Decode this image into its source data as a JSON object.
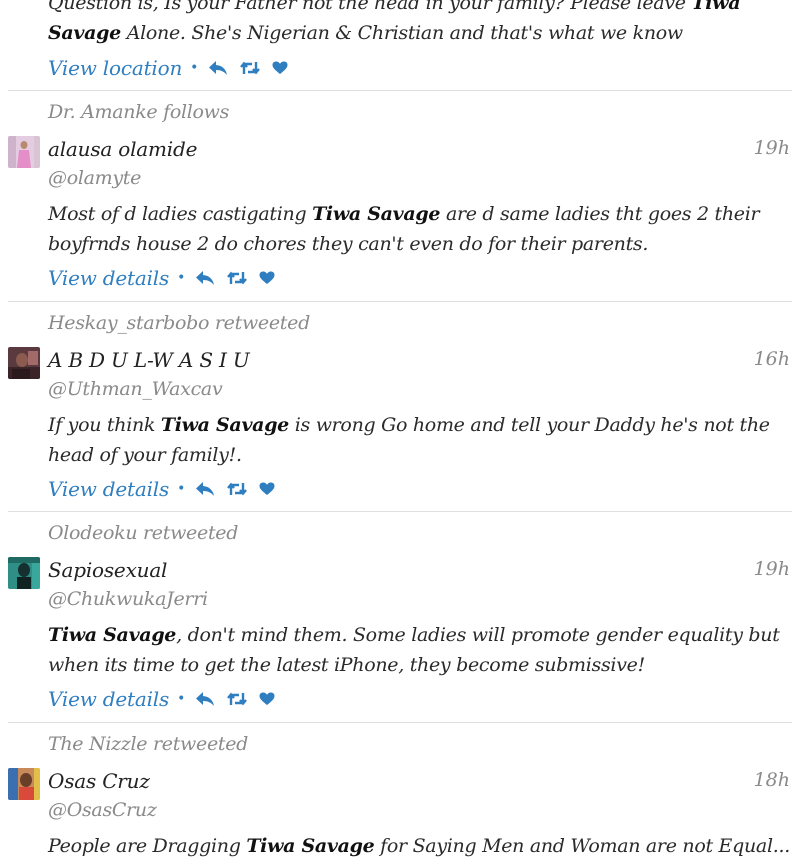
{
  "colors": {
    "link": "#2f7ec0",
    "muted": "#8a8a8a",
    "text": "#2a2a2a",
    "divider": "#dfdfdf"
  },
  "icons": [
    "reply-icon",
    "retweet-icon",
    "favorite-icon"
  ],
  "top_partial": {
    "line1_prefix": "Question is, Is your Father not the head in your family? Please leave ",
    "line1_bold": "Tiwa",
    "line2_bold": "Savage",
    "line2_rest": " Alone. She's Nigerian & Christian and that's what we know",
    "action_label": "View location"
  },
  "tweets": [
    {
      "context": "Dr. Amanke follows",
      "name": "alausa olamide",
      "handle": "@olamyte",
      "time": "19h",
      "text": {
        "before": "Most of d ladies castigating ",
        "bold": "Tiwa Savage",
        "after": " are d same ladies tht goes 2 their boyfrnds house 2 do chores they can't even do for their parents."
      },
      "action_label": "View details"
    },
    {
      "context": "Heskay_starbobo retweeted",
      "name": "A B D U L-W A S I U",
      "handle": "@Uthman_Waxcav",
      "time": "16h",
      "text": {
        "before": "If you think ",
        "bold": "Tiwa Savage",
        "after": " is wrong Go home and tell your Daddy he's not the head of your family!."
      },
      "action_label": "View details"
    },
    {
      "context": "Olodeoku retweeted",
      "name": "Sapiosexual",
      "handle": "@ChukwukaJerri",
      "time": "19h",
      "text": {
        "before": "",
        "bold": "Tiwa Savage",
        "after": ", don't mind them. Some ladies will promote gender equality but when its time to get the latest iPhone, they become submissive!"
      },
      "action_label": "View details"
    },
    {
      "context": "The Nizzle retweeted",
      "name": "Osas Cruz",
      "handle": "@OsasCruz",
      "time": "18h",
      "text": {
        "before": "People are Dragging ",
        "bold": "Tiwa Savage",
        "after": " for Saying Men and Woman are not Equal..."
      },
      "action_label": ""
    }
  ]
}
